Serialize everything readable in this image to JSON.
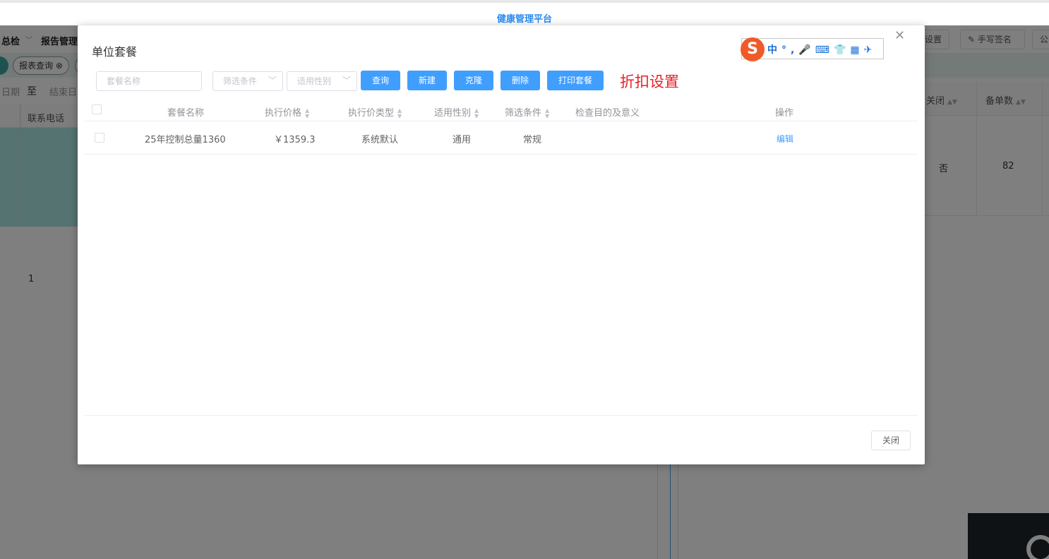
{
  "app": {
    "title": "健康管理平台"
  },
  "background": {
    "nav": [
      {
        "label": "总检",
        "has_chevron": true
      },
      {
        "label": "报告管理",
        "has_chevron": false
      }
    ],
    "nav_buttons": [
      "设置",
      "手写签名",
      "公"
    ],
    "tags": [
      "报表查询"
    ],
    "filter": {
      "start_fragment": "日期",
      "to": "至",
      "end_placeholder": "结束日"
    },
    "left_table": {
      "header": "联系电话",
      "row_value": "1"
    },
    "right_table": {
      "headers": [
        "关闭",
        "备单数"
      ],
      "row": [
        "否",
        "82"
      ]
    }
  },
  "dialog": {
    "title": "单位套餐",
    "ime_icons": [
      "中",
      "°,",
      "mic-icon",
      "keyboard-icon",
      "shirt-icon",
      "apps-icon",
      "tool-icon"
    ],
    "search": {
      "placeholder": "套餐名称",
      "value": ""
    },
    "filter_select": {
      "placeholder": "筛选条件"
    },
    "gender_select": {
      "placeholder": "适用性别"
    },
    "buttons": {
      "query": "查询",
      "create": "新建",
      "clone": "克隆",
      "delete": "删除",
      "print": "打印套餐"
    },
    "discount_setting": "折扣设置",
    "table": {
      "headers": [
        "套餐名称",
        "执行价格",
        "执行价类型",
        "适用性别",
        "筛选条件",
        "检查目的及意义",
        "操作"
      ],
      "rows": [
        {
          "name": "25年控制总量1360",
          "price": "￥1359.3",
          "price_type": "系统默认",
          "gender": "通用",
          "condition": "常规",
          "purpose": "",
          "action": "编辑"
        }
      ]
    },
    "close_label": "关闭"
  },
  "colors": {
    "primary": "#409eff",
    "accent_red": "#e6212a",
    "brand_blue": "#2d8cf0"
  }
}
